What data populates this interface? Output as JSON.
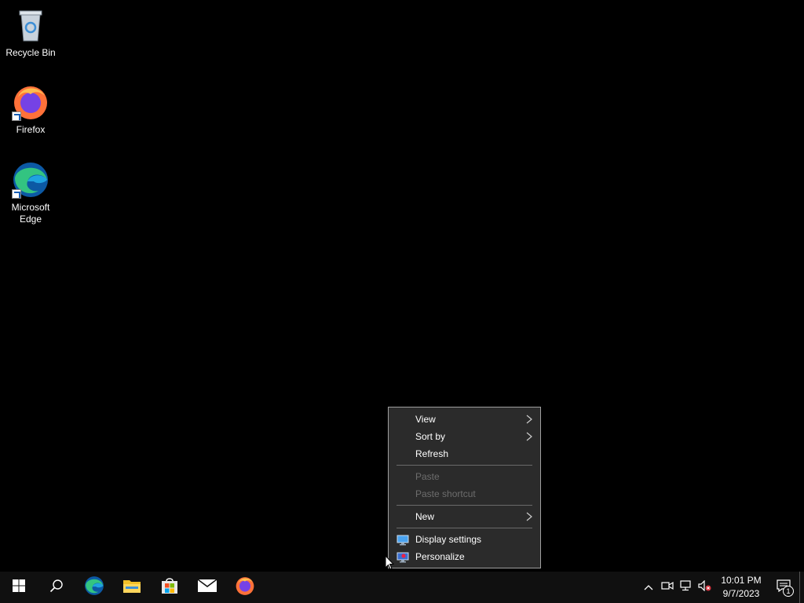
{
  "desktop": {
    "icons": [
      {
        "label": "Recycle Bin",
        "icon": "recycle-bin-icon"
      },
      {
        "label": "Firefox",
        "icon": "firefox-icon"
      },
      {
        "label": "Microsoft Edge",
        "icon": "edge-icon"
      }
    ]
  },
  "context_menu": {
    "items": [
      {
        "label": "View",
        "submenu": true
      },
      {
        "label": "Sort by",
        "submenu": true
      },
      {
        "label": "Refresh"
      },
      {
        "label": "Paste",
        "disabled": true
      },
      {
        "label": "Paste shortcut",
        "disabled": true
      },
      {
        "label": "New",
        "submenu": true
      },
      {
        "label": "Display settings",
        "icon": "display-settings-icon"
      },
      {
        "label": "Personalize",
        "icon": "personalize-icon"
      }
    ]
  },
  "taskbar": {
    "apps": [
      "start-icon",
      "search-icon",
      "edge-icon",
      "file-explorer-icon",
      "microsoft-store-icon",
      "mail-icon",
      "firefox-icon"
    ],
    "tray_icons": [
      "show-hidden-icons-chevron",
      "meet-now-icon",
      "network-icon",
      "volume-muted-icon"
    ],
    "clock": {
      "time": "10:01 PM",
      "date": "9/7/2023"
    },
    "notifications": {
      "count": "1"
    }
  },
  "colors": {
    "desktop_bg": "#000000",
    "menu_bg": "#2b2b2b",
    "taskbar_bg": "#101010"
  }
}
